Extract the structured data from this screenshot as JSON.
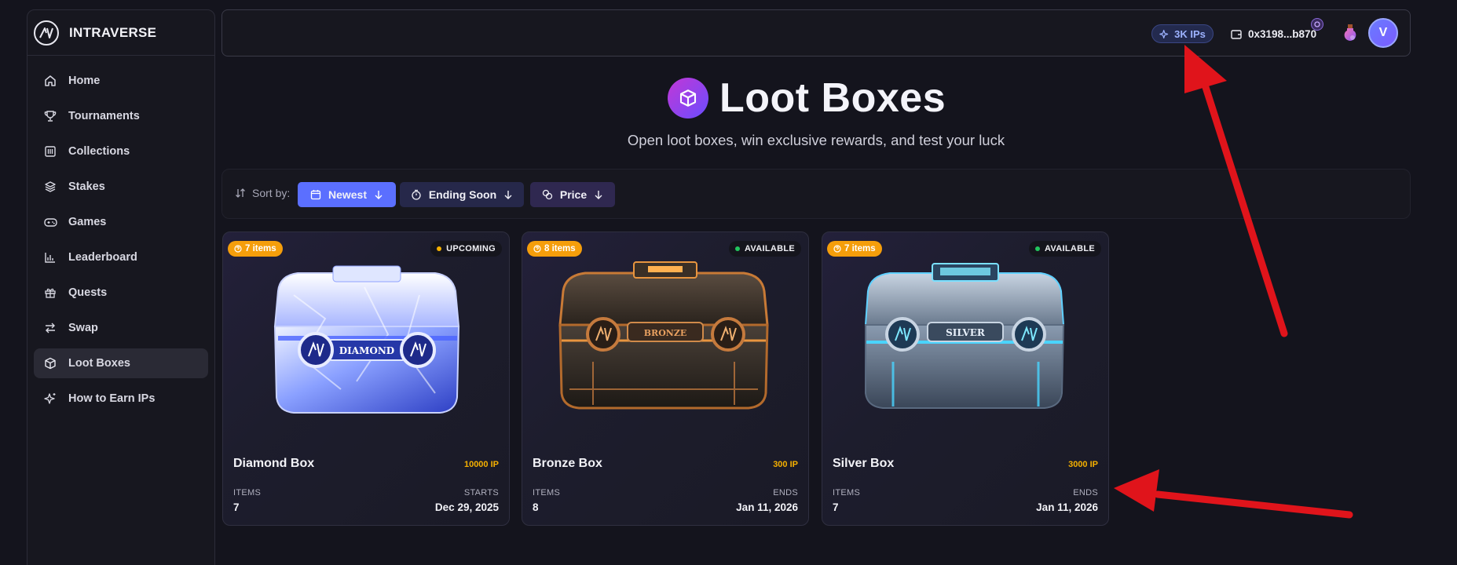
{
  "brand": {
    "name": "INTRAVERSE"
  },
  "sidebar": {
    "items": [
      {
        "label": "Home",
        "icon": "home-icon"
      },
      {
        "label": "Tournaments",
        "icon": "trophy-icon"
      },
      {
        "label": "Collections",
        "icon": "collections-icon"
      },
      {
        "label": "Stakes",
        "icon": "layers-icon"
      },
      {
        "label": "Games",
        "icon": "gamepad-icon"
      },
      {
        "label": "Leaderboard",
        "icon": "bar-chart-icon"
      },
      {
        "label": "Quests",
        "icon": "gift-icon"
      },
      {
        "label": "Swap",
        "icon": "swap-icon"
      },
      {
        "label": "Loot Boxes",
        "icon": "box-icon",
        "active": true
      },
      {
        "label": "How to Earn IPs",
        "icon": "sparkle-icon"
      }
    ]
  },
  "header": {
    "ips": "3K IPs",
    "wallet": "0x3198...b870",
    "avatar_initial": "V"
  },
  "hero": {
    "title": "Loot Boxes",
    "subtitle": "Open loot boxes, win exclusive rewards, and test your luck"
  },
  "sort": {
    "label": "Sort by:",
    "options": [
      {
        "label": "Newest",
        "active": true
      },
      {
        "label": "Ending Soon"
      },
      {
        "label": "Price"
      }
    ]
  },
  "cards": [
    {
      "name": "Diamond Box",
      "badge": "7 items",
      "status": "UPCOMING",
      "status_color": "#f5b000",
      "price": "10000 IP",
      "items_label": "ITEMS",
      "items": "7",
      "date_label": "STARTS",
      "date": "Dec 29, 2025",
      "plate": "DIAMOND"
    },
    {
      "name": "Bronze Box",
      "badge": "8 items",
      "status": "AVAILABLE",
      "status_color": "#22c55e",
      "price": "300 IP",
      "items_label": "ITEMS",
      "items": "8",
      "date_label": "ENDS",
      "date": "Jan 11, 2026",
      "plate": "BRONZE"
    },
    {
      "name": "Silver Box",
      "badge": "7 items",
      "status": "AVAILABLE",
      "status_color": "#22c55e",
      "price": "3000 IP",
      "items_label": "ITEMS",
      "items": "7",
      "date_label": "ENDS",
      "date": "Jan 11, 2026",
      "plate": "SILVER"
    }
  ],
  "colors": {
    "accent": "#5b6fff",
    "annotation_arrow": "#e0141b",
    "price": "#f5b000",
    "badge": "#f59e0b"
  }
}
